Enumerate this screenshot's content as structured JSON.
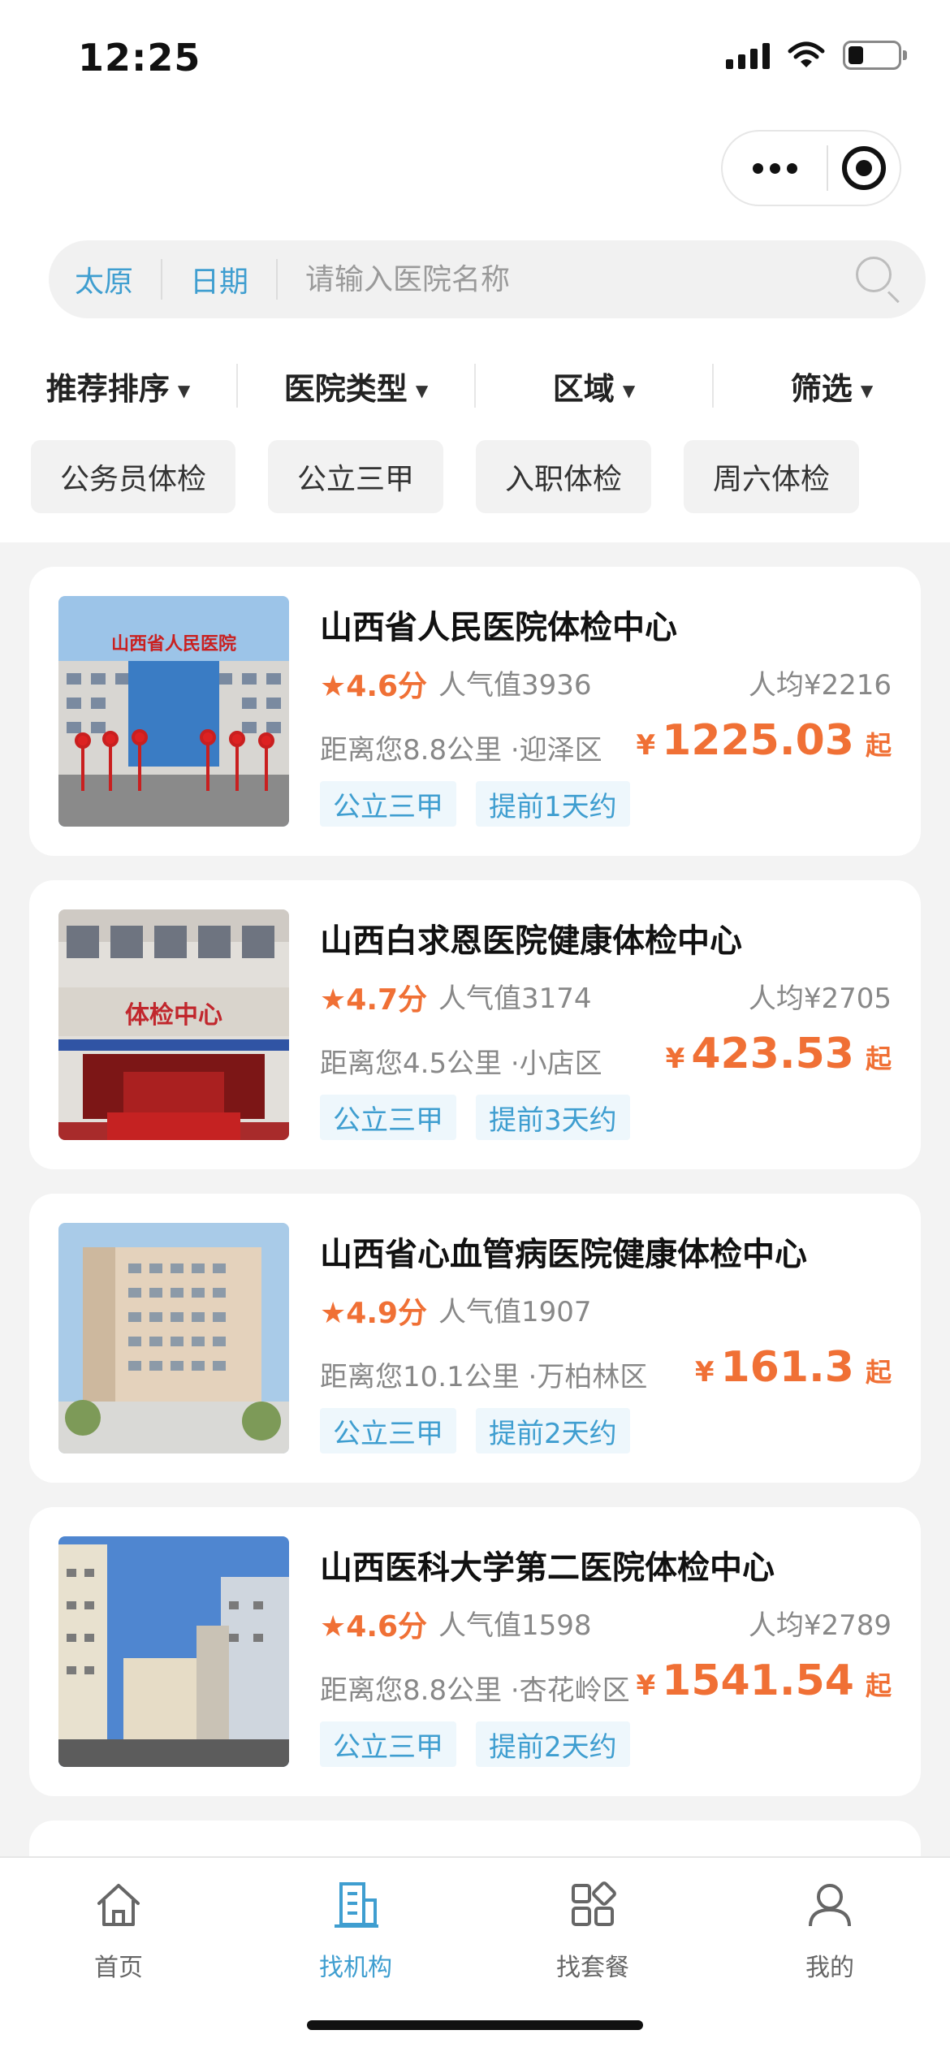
{
  "status_bar": {
    "time": "12:25"
  },
  "search": {
    "city": "太原",
    "date": "日期",
    "placeholder": "请输入医院名称"
  },
  "sort_bar": {
    "items": [
      "推荐排序",
      "医院类型",
      "区域",
      "筛选"
    ]
  },
  "chips": [
    "公务员体检",
    "公立三甲",
    "入职体检",
    "周六体检"
  ],
  "hospitals": [
    {
      "name": "山西省人民医院体检中心",
      "rating": "4.6分",
      "popularity": "人气值3936",
      "avg_price": "人均¥2216",
      "distance": "距离您8.8公里 ·迎泽区",
      "price_currency": "¥",
      "price": "1225.03",
      "price_suffix": "起",
      "tags": [
        "公立三甲",
        "提前1天约"
      ],
      "photo_sign": "山西省人民医院"
    },
    {
      "name": "山西白求恩医院健康体检中心",
      "rating": "4.7分",
      "popularity": "人气值3174",
      "avg_price": "人均¥2705",
      "distance": "距离您4.5公里 ·小店区",
      "price_currency": "¥",
      "price": "423.53",
      "price_suffix": "起",
      "tags": [
        "公立三甲",
        "提前3天约"
      ],
      "photo_sign": "体检中心"
    },
    {
      "name": "山西省心血管病医院健康体检中心",
      "rating": "4.9分",
      "popularity": "人气值1907",
      "avg_price": "",
      "distance": "距离您10.1公里 ·万柏林区",
      "price_currency": "¥",
      "price": "161.3",
      "price_suffix": "起",
      "tags": [
        "公立三甲",
        "提前2天约"
      ]
    },
    {
      "name": "山西医科大学第二医院体检中心",
      "rating": "4.6分",
      "popularity": "人气值1598",
      "avg_price": "人均¥2789",
      "distance": "距离您8.8公里 ·杏花岭区",
      "price_currency": "¥",
      "price": "1541.54",
      "price_suffix": "起",
      "tags": [
        "公立三甲",
        "提前2天约"
      ]
    }
  ],
  "tabbar": {
    "items": [
      {
        "label": "首页",
        "icon": "home-icon"
      },
      {
        "label": "找机构",
        "icon": "building-icon"
      },
      {
        "label": "找套餐",
        "icon": "grid-icon"
      },
      {
        "label": "我的",
        "icon": "user-icon"
      }
    ]
  },
  "colors": {
    "accent": "#3f9ed0",
    "price": "#f07035"
  }
}
